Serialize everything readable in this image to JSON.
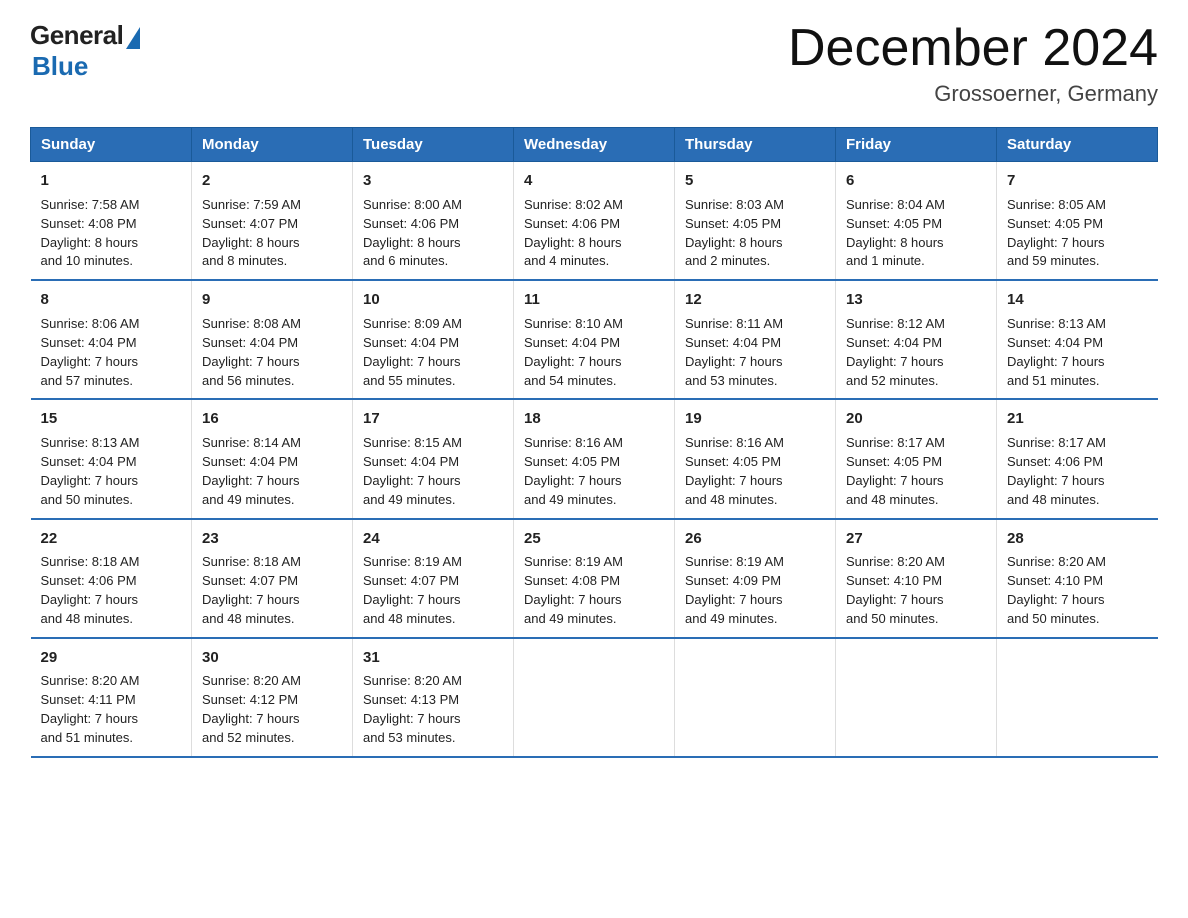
{
  "logo": {
    "general": "General",
    "blue": "Blue",
    "tagline": "Blue"
  },
  "title": "December 2024",
  "subtitle": "Grossoerner, Germany",
  "weekdays": [
    "Sunday",
    "Monday",
    "Tuesday",
    "Wednesday",
    "Thursday",
    "Friday",
    "Saturday"
  ],
  "weeks": [
    [
      {
        "day": "1",
        "info": "Sunrise: 7:58 AM\nSunset: 4:08 PM\nDaylight: 8 hours\nand 10 minutes."
      },
      {
        "day": "2",
        "info": "Sunrise: 7:59 AM\nSunset: 4:07 PM\nDaylight: 8 hours\nand 8 minutes."
      },
      {
        "day": "3",
        "info": "Sunrise: 8:00 AM\nSunset: 4:06 PM\nDaylight: 8 hours\nand 6 minutes."
      },
      {
        "day": "4",
        "info": "Sunrise: 8:02 AM\nSunset: 4:06 PM\nDaylight: 8 hours\nand 4 minutes."
      },
      {
        "day": "5",
        "info": "Sunrise: 8:03 AM\nSunset: 4:05 PM\nDaylight: 8 hours\nand 2 minutes."
      },
      {
        "day": "6",
        "info": "Sunrise: 8:04 AM\nSunset: 4:05 PM\nDaylight: 8 hours\nand 1 minute."
      },
      {
        "day": "7",
        "info": "Sunrise: 8:05 AM\nSunset: 4:05 PM\nDaylight: 7 hours\nand 59 minutes."
      }
    ],
    [
      {
        "day": "8",
        "info": "Sunrise: 8:06 AM\nSunset: 4:04 PM\nDaylight: 7 hours\nand 57 minutes."
      },
      {
        "day": "9",
        "info": "Sunrise: 8:08 AM\nSunset: 4:04 PM\nDaylight: 7 hours\nand 56 minutes."
      },
      {
        "day": "10",
        "info": "Sunrise: 8:09 AM\nSunset: 4:04 PM\nDaylight: 7 hours\nand 55 minutes."
      },
      {
        "day": "11",
        "info": "Sunrise: 8:10 AM\nSunset: 4:04 PM\nDaylight: 7 hours\nand 54 minutes."
      },
      {
        "day": "12",
        "info": "Sunrise: 8:11 AM\nSunset: 4:04 PM\nDaylight: 7 hours\nand 53 minutes."
      },
      {
        "day": "13",
        "info": "Sunrise: 8:12 AM\nSunset: 4:04 PM\nDaylight: 7 hours\nand 52 minutes."
      },
      {
        "day": "14",
        "info": "Sunrise: 8:13 AM\nSunset: 4:04 PM\nDaylight: 7 hours\nand 51 minutes."
      }
    ],
    [
      {
        "day": "15",
        "info": "Sunrise: 8:13 AM\nSunset: 4:04 PM\nDaylight: 7 hours\nand 50 minutes."
      },
      {
        "day": "16",
        "info": "Sunrise: 8:14 AM\nSunset: 4:04 PM\nDaylight: 7 hours\nand 49 minutes."
      },
      {
        "day": "17",
        "info": "Sunrise: 8:15 AM\nSunset: 4:04 PM\nDaylight: 7 hours\nand 49 minutes."
      },
      {
        "day": "18",
        "info": "Sunrise: 8:16 AM\nSunset: 4:05 PM\nDaylight: 7 hours\nand 49 minutes."
      },
      {
        "day": "19",
        "info": "Sunrise: 8:16 AM\nSunset: 4:05 PM\nDaylight: 7 hours\nand 48 minutes."
      },
      {
        "day": "20",
        "info": "Sunrise: 8:17 AM\nSunset: 4:05 PM\nDaylight: 7 hours\nand 48 minutes."
      },
      {
        "day": "21",
        "info": "Sunrise: 8:17 AM\nSunset: 4:06 PM\nDaylight: 7 hours\nand 48 minutes."
      }
    ],
    [
      {
        "day": "22",
        "info": "Sunrise: 8:18 AM\nSunset: 4:06 PM\nDaylight: 7 hours\nand 48 minutes."
      },
      {
        "day": "23",
        "info": "Sunrise: 8:18 AM\nSunset: 4:07 PM\nDaylight: 7 hours\nand 48 minutes."
      },
      {
        "day": "24",
        "info": "Sunrise: 8:19 AM\nSunset: 4:07 PM\nDaylight: 7 hours\nand 48 minutes."
      },
      {
        "day": "25",
        "info": "Sunrise: 8:19 AM\nSunset: 4:08 PM\nDaylight: 7 hours\nand 49 minutes."
      },
      {
        "day": "26",
        "info": "Sunrise: 8:19 AM\nSunset: 4:09 PM\nDaylight: 7 hours\nand 49 minutes."
      },
      {
        "day": "27",
        "info": "Sunrise: 8:20 AM\nSunset: 4:10 PM\nDaylight: 7 hours\nand 50 minutes."
      },
      {
        "day": "28",
        "info": "Sunrise: 8:20 AM\nSunset: 4:10 PM\nDaylight: 7 hours\nand 50 minutes."
      }
    ],
    [
      {
        "day": "29",
        "info": "Sunrise: 8:20 AM\nSunset: 4:11 PM\nDaylight: 7 hours\nand 51 minutes."
      },
      {
        "day": "30",
        "info": "Sunrise: 8:20 AM\nSunset: 4:12 PM\nDaylight: 7 hours\nand 52 minutes."
      },
      {
        "day": "31",
        "info": "Sunrise: 8:20 AM\nSunset: 4:13 PM\nDaylight: 7 hours\nand 53 minutes."
      },
      null,
      null,
      null,
      null
    ]
  ]
}
